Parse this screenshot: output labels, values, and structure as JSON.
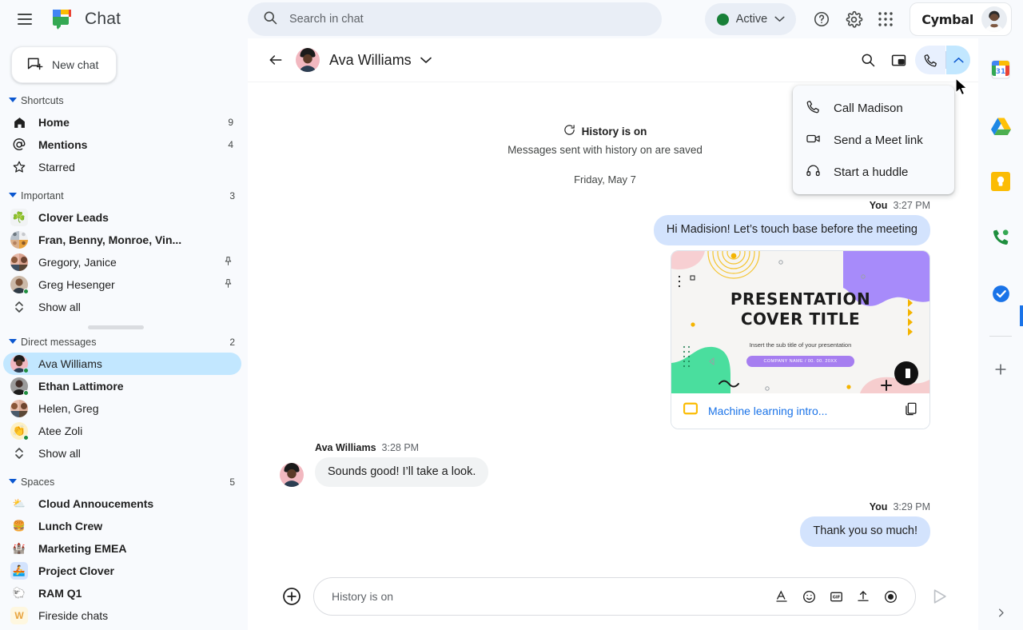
{
  "topbar": {
    "brand_title": "Chat",
    "menu_icon": "hamburger-icon",
    "new_chat_label": "New chat",
    "search_placeholder": "Search in chat",
    "status_label": "Active",
    "status_color": "#188038",
    "help_icon": "help-icon",
    "settings_icon": "gear-icon",
    "apps_icon": "apps-grid-icon",
    "account_brand": "Cymbal"
  },
  "sidebar": {
    "sections": [
      {
        "title": "Shortcuts",
        "count": "",
        "items": [
          {
            "label": "Home",
            "icon": "home-icon",
            "trail": "9",
            "unread": true,
            "kind": "glyph"
          },
          {
            "label": "Mentions",
            "icon": "at-icon",
            "trail": "4",
            "unread": true,
            "kind": "glyph"
          },
          {
            "label": "Starred",
            "icon": "star-icon",
            "trail": "",
            "unread": false,
            "kind": "glyph"
          }
        ]
      },
      {
        "title": "Important",
        "count": "3",
        "items": [
          {
            "label": "Clover Leads",
            "icon": "clover-emoji",
            "emoji": "☘️",
            "trail": "unread-dot",
            "unread": true,
            "kind": "square",
            "bg": "#f1f3f4"
          },
          {
            "label": "Fran, Benny, Monroe, Vin...",
            "icon": "group-avatar",
            "trail": "unread-dot",
            "unread": true,
            "kind": "group"
          },
          {
            "label": "Gregory, Janice",
            "icon": "group-avatar",
            "trail": "pin",
            "unread": false,
            "kind": "group2"
          },
          {
            "label": "Greg Hesenger",
            "icon": "person-avatar",
            "trail": "pin",
            "unread": false,
            "kind": "person",
            "presence": true
          },
          {
            "label": "Show all",
            "icon": "expand-icon",
            "trail": "",
            "unread": false,
            "kind": "showall"
          }
        ]
      },
      {
        "title": "Direct messages",
        "count": "2",
        "items": [
          {
            "label": "Ava Williams",
            "icon": "person-avatar",
            "trail": "unread-dot",
            "unread": false,
            "selected": true,
            "kind": "person",
            "presence": true
          },
          {
            "label": "Ethan Lattimore",
            "icon": "person-avatar",
            "trail": "unread-dot",
            "unread": true,
            "kind": "person2",
            "presence": true
          },
          {
            "label": "Helen, Greg",
            "icon": "group-avatar",
            "trail": "",
            "unread": false,
            "kind": "group2"
          },
          {
            "label": "Atee Zoli",
            "icon": "person-avatar",
            "trail": "",
            "unread": false,
            "kind": "emojiav",
            "emoji": "👏",
            "presence": true
          },
          {
            "label": "Show all",
            "icon": "expand-icon",
            "trail": "",
            "unread": false,
            "kind": "showall"
          }
        ]
      },
      {
        "title": "Spaces",
        "count": "5",
        "items": [
          {
            "label": "Cloud Annoucements",
            "icon": "cloud-emoji",
            "emoji": "⛅",
            "trail": "unread-dot",
            "unread": true,
            "kind": "square",
            "bg": "transparent"
          },
          {
            "label": "Lunch Crew",
            "icon": "burger-emoji",
            "emoji": "🍔",
            "trail": "unread-dot",
            "unread": true,
            "kind": "square",
            "bg": "transparent"
          },
          {
            "label": "Marketing EMEA",
            "icon": "castle-emoji",
            "emoji": "🏰",
            "trail": "",
            "unread": true,
            "kind": "square",
            "bg": "transparent"
          },
          {
            "label": "Project Clover",
            "icon": "boat-emoji",
            "emoji": "🚣",
            "trail": "",
            "unread": true,
            "kind": "square",
            "bg": "#d3e3fd"
          },
          {
            "label": "RAM Q1",
            "icon": "llama-emoji",
            "emoji": "🐑",
            "trail": "",
            "unread": true,
            "kind": "square",
            "bg": "transparent"
          },
          {
            "label": "Fireside chats",
            "icon": "letter-avatar-w",
            "emoji": "W",
            "trail": "",
            "unread": false,
            "kind": "letter",
            "bg": "#fef7e0",
            "fg": "#e8a33d"
          }
        ]
      }
    ]
  },
  "chat_header": {
    "back_icon": "back-arrow-icon",
    "title": "Ava Williams",
    "caret_icon": "chevron-down-icon",
    "search_icon": "search-icon",
    "pip_icon": "picture-in-picture-icon",
    "call_icon": "phone-icon",
    "call_caret_icon": "chevron-up-icon"
  },
  "call_menu": {
    "items": [
      {
        "label": "Call Madison",
        "icon": "phone-icon"
      },
      {
        "label": "Send a Meet link",
        "icon": "video-camera-icon"
      },
      {
        "label": "Start a huddle",
        "icon": "headphones-icon"
      }
    ]
  },
  "conversation": {
    "history_notice_title": "History is on",
    "history_notice_sub": "Messages sent with history on are saved",
    "date_separator": "Friday, May 7",
    "messages": [
      {
        "author": "You",
        "time": "3:27 PM",
        "text": "Hi Madision! Let’s touch base before the meeting",
        "side": "right"
      },
      {
        "author": "Ava Williams",
        "time": "3:28 PM",
        "text": "Sounds good! I’ll take a look.",
        "side": "left"
      },
      {
        "author": "You",
        "time": "3:29 PM",
        "text": "Thank you so much!",
        "side": "right"
      }
    ],
    "attachment": {
      "slide_title_line1": "PRESENTATION",
      "slide_title_line2": "COVER TITLE",
      "slide_subtitle": "Insert the sub title of your presentation",
      "slide_pill": "COMPANY NAME / 00. 00. 20XX",
      "file_name": "Machine learning intro...",
      "file_icon": "google-slides-icon",
      "copy_icon": "copy-icon"
    }
  },
  "composer": {
    "plus_icon": "add-icon",
    "placeholder": "History is on",
    "format_icon": "text-format-icon",
    "emoji_icon": "emoji-icon",
    "gif_icon": "gif-icon",
    "upload_icon": "upload-icon",
    "record_icon": "record-icon",
    "send_icon": "send-icon"
  },
  "right_rail": {
    "items": [
      {
        "name": "google-calendar-icon",
        "day": "31"
      },
      {
        "name": "google-drive-icon"
      },
      {
        "name": "google-keep-icon"
      },
      {
        "name": "google-voice-icon"
      },
      {
        "name": "google-tasks-icon"
      }
    ],
    "add_label": "add-icon",
    "expand_icon": "chevron-right-icon"
  }
}
